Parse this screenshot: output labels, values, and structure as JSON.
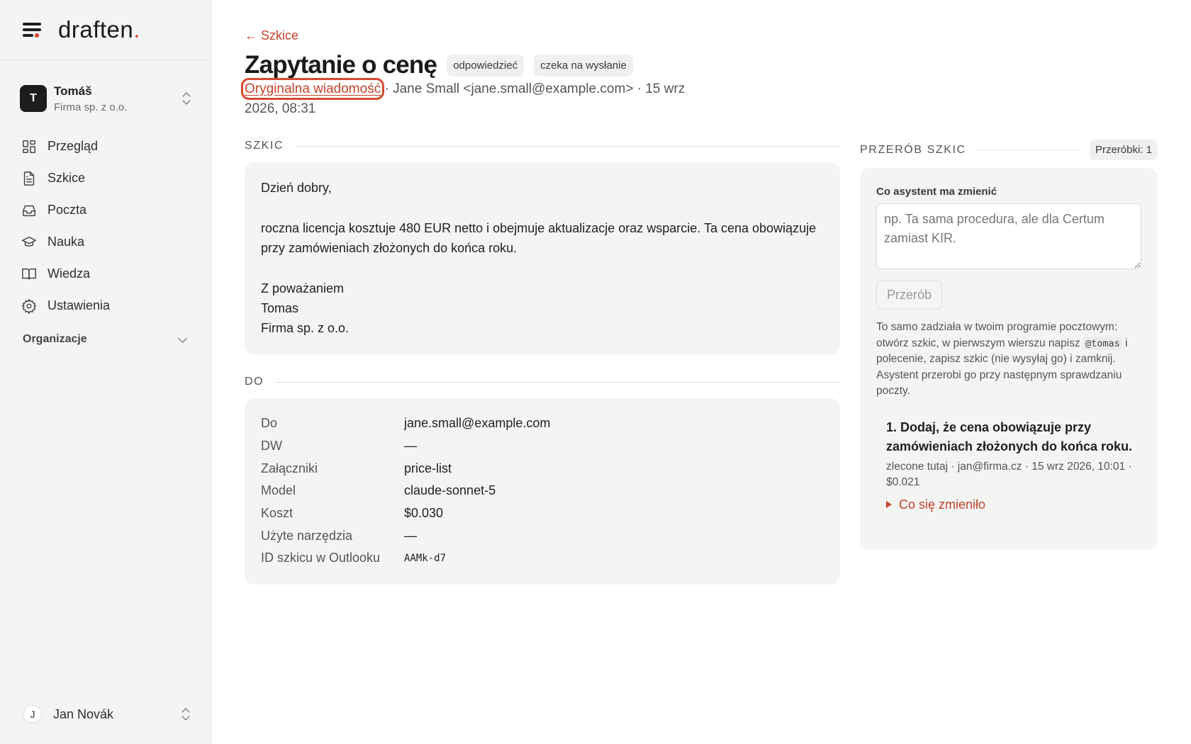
{
  "brand": {
    "name": "draften",
    "dot": "."
  },
  "org": {
    "initial": "T",
    "name": "Tomáš",
    "company": "Firma sp. z o.o."
  },
  "nav": {
    "items": [
      {
        "label": "Przegląd",
        "icon": "dashboard-icon"
      },
      {
        "label": "Szkice",
        "icon": "document-icon"
      },
      {
        "label": "Poczta",
        "icon": "inbox-icon"
      },
      {
        "label": "Nauka",
        "icon": "graduation-cap-icon"
      },
      {
        "label": "Wiedza",
        "icon": "book-icon"
      },
      {
        "label": "Ustawienia",
        "icon": "gear-icon"
      }
    ],
    "orgs_label": "Organizacje"
  },
  "user": {
    "initial": "J",
    "name": "Jan Novák"
  },
  "header": {
    "back_label": "← Szkice",
    "title": "Zapytanie o cenę",
    "badges": [
      "odpowiedzieć",
      "czeka na wysłanie"
    ],
    "orig_link": "Oryginalna wiadomość",
    "meta_rest": " · Jane Small <jane.small@example.com> · 15 wrz 2026, 08:31"
  },
  "draft": {
    "section_label": "SZKIC",
    "greeting": "Dzień dobry,",
    "body": "roczna licencja kosztuje 480 EUR netto i obejmuje aktualizacje oraz wsparcie. Ta cena obowiązuje przy zamówieniach złożonych do końca roku.",
    "closing": "Z poważaniem",
    "sign_name": "Tomas",
    "sign_company": "Firma sp. z o.o."
  },
  "details": {
    "section_label": "DO",
    "rows": [
      {
        "key": "Do",
        "value": "jane.small@example.com"
      },
      {
        "key": "DW",
        "value": "—"
      },
      {
        "key": "Załączniki",
        "value": "price-list"
      },
      {
        "key": "Model",
        "value": "claude-sonnet-5"
      },
      {
        "key": "Koszt",
        "value": "$0.030"
      },
      {
        "key": "Użyte narzędzia",
        "value": "—"
      },
      {
        "key": "ID szkicu w Outlooku",
        "value": "AAMk-d7"
      }
    ]
  },
  "rework": {
    "section_label": "PRZERÓB SZKIC",
    "count_label": "Przeróbki: 1",
    "field_label": "Co asystent ma zmienić",
    "placeholder": "np. Ta sama procedura, ale dla Certum zamiast KIR.",
    "button_label": "Przerób",
    "hint_before": "To samo zadziała w twoim programie pocztowym: otwórz szkic, w pierwszym wierszu napisz ",
    "hint_code": "@tomas",
    "hint_after": " i polecenie, zapisz szkic (nie wysyłaj go) i zamknij. Asystent przerobi go przy następnym sprawdzaniu poczty.",
    "history": [
      {
        "title": "1. Dodaj, że cena obowiązuje przy zamówieniach złożonych do końca roku.",
        "meta": "zlecone tutaj · jan@firma.cz · 15 wrz 2026, 10:01 · $0.021",
        "toggle": "Co się zmieniło"
      }
    ]
  },
  "colors": {
    "accent": "#c4442c",
    "sidebar_bg": "#f4f4f3",
    "card_bg": "#f4f4f3"
  }
}
